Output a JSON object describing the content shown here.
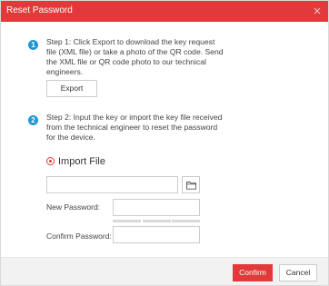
{
  "dialog": {
    "title": "Reset Password",
    "accent_color": "#e23a3a",
    "info_color": "#2196d3"
  },
  "step1": {
    "number": "1",
    "lines": [
      "Step 1: Click Export to download the key request",
      "file (XML file) or take a photo of the QR code. Send",
      "the XML file or QR code photo to our technical",
      "engineers."
    ],
    "export_label": "Export"
  },
  "step2": {
    "number": "2",
    "lines": [
      "Step 2: Input the key or import the key file received",
      "from the technical engineer to reset the password",
      "for the device."
    ]
  },
  "import": {
    "option_label": "Import File",
    "selected": true,
    "file_value": "",
    "browse_icon": "folder-icon"
  },
  "password": {
    "new_label": "New Password:",
    "confirm_label": "Confirm Password:",
    "new_value": "",
    "confirm_value": "",
    "strength_segments": 3
  },
  "footer": {
    "confirm_label": "Confirm",
    "cancel_label": "Cancel"
  }
}
